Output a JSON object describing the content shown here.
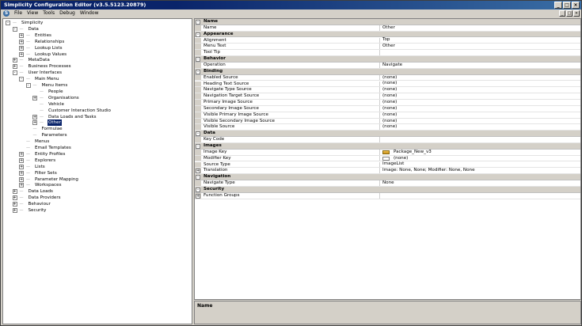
{
  "window": {
    "title": "Simplicity Configuration Editor (v3.5.5123.20879)",
    "controls": [
      "_",
      "□",
      "×"
    ]
  },
  "menu": [
    "File",
    "View",
    "Tools",
    "Debug",
    "Window"
  ],
  "tree": [
    {
      "label": "Simplicity",
      "level": 0,
      "toggle": "-"
    },
    {
      "label": "Data",
      "level": 1,
      "toggle": "-"
    },
    {
      "label": "Entities",
      "level": 2,
      "toggle": "+"
    },
    {
      "label": "Relationships",
      "level": 2,
      "toggle": "+"
    },
    {
      "label": "Lookup Lists",
      "level": 2,
      "toggle": "+"
    },
    {
      "label": "Lookup Values",
      "level": 2,
      "toggle": "+"
    },
    {
      "label": "MetaData",
      "level": 1,
      "toggle": "+"
    },
    {
      "label": "Business Processes",
      "level": 1,
      "toggle": "+"
    },
    {
      "label": "User Interfaces",
      "level": 1,
      "toggle": "-"
    },
    {
      "label": "Main Menu",
      "level": 2,
      "toggle": "-"
    },
    {
      "label": "Menu Items",
      "level": 3,
      "toggle": "-"
    },
    {
      "label": "People",
      "level": 4,
      "toggle": ""
    },
    {
      "label": "Organisations",
      "level": 4,
      "toggle": "+"
    },
    {
      "label": "Vehicle",
      "level": 4,
      "toggle": ""
    },
    {
      "label": "Customer Interaction Studio",
      "level": 4,
      "toggle": ""
    },
    {
      "label": "Data Loads and Tasks",
      "level": 4,
      "toggle": "+"
    },
    {
      "label": "Other",
      "level": 4,
      "toggle": "+",
      "selected": true
    },
    {
      "label": "Formulae",
      "level": 3,
      "toggle": ""
    },
    {
      "label": "Parameters",
      "level": 3,
      "toggle": ""
    },
    {
      "label": "Menus",
      "level": 2,
      "toggle": ""
    },
    {
      "label": "Email Templates",
      "level": 2,
      "toggle": ""
    },
    {
      "label": "Entity Profiles",
      "level": 2,
      "toggle": "+"
    },
    {
      "label": "Explorers",
      "level": 2,
      "toggle": "+"
    },
    {
      "label": "Lists",
      "level": 2,
      "toggle": "+"
    },
    {
      "label": "Filter Sets",
      "level": 2,
      "toggle": "+"
    },
    {
      "label": "Parameter Mapping",
      "level": 2,
      "toggle": "+"
    },
    {
      "label": "Workspaces",
      "level": 2,
      "toggle": "+"
    },
    {
      "label": "Data Loads",
      "level": 1,
      "toggle": "+"
    },
    {
      "label": "Data Providers",
      "level": 1,
      "toggle": "+"
    },
    {
      "label": "Behaviour",
      "level": 1,
      "toggle": "+"
    },
    {
      "label": "Security",
      "level": 1,
      "toggle": "+"
    }
  ],
  "properties": [
    {
      "category": "Name"
    },
    {
      "name": "Name",
      "value": "Other"
    },
    {
      "category": "Appearance"
    },
    {
      "name": "Alignment",
      "value": "Top"
    },
    {
      "name": "Menu Text",
      "value": "Other"
    },
    {
      "name": "Tool Tip",
      "value": ""
    },
    {
      "category": "Behavior"
    },
    {
      "name": "Operation",
      "value": "Navigate"
    },
    {
      "category": "Binding"
    },
    {
      "name": "Enabled Source",
      "value": "(none)"
    },
    {
      "name": "Heading Text Source",
      "value": "(none)"
    },
    {
      "name": "Navigate Type Source",
      "value": "(none)"
    },
    {
      "name": "Navigation Target Source",
      "value": "(none)"
    },
    {
      "name": "Primary Image Source",
      "value": "(none)"
    },
    {
      "name": "Secondary Image Source",
      "value": "(none)"
    },
    {
      "name": "Visible Primary Image Source",
      "value": "(none)"
    },
    {
      "name": "Visible Secondary Image Source",
      "value": "(none)"
    },
    {
      "name": "Visible Source",
      "value": "(none)"
    },
    {
      "category": "Data"
    },
    {
      "name": "Key Code",
      "value": ""
    },
    {
      "category": "Images"
    },
    {
      "name": "Image Key",
      "value": "Package_New_v3",
      "swatch": "pkg"
    },
    {
      "name": "Modifier Key",
      "value": "(none)",
      "swatch": "none"
    },
    {
      "name": "Source Type",
      "value": "ImageList"
    },
    {
      "name": "Translation",
      "value": "Image: None, None; Modifier: None, None",
      "toggle": "+"
    },
    {
      "category": "Navigation"
    },
    {
      "name": "Navigate Type",
      "value": "None"
    },
    {
      "category": "Security"
    },
    {
      "name": "Function Groups",
      "value": "",
      "toggle": "+"
    }
  ],
  "description": {
    "title": "Name"
  }
}
